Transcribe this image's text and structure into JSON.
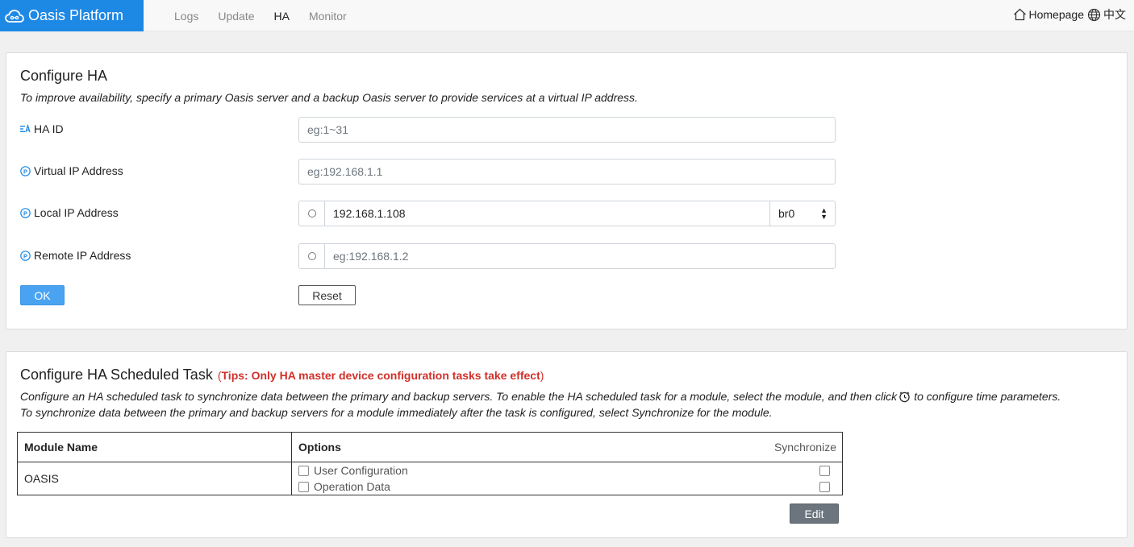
{
  "brand": {
    "name": "Oasis Platform"
  },
  "nav": {
    "items": [
      {
        "label": "Logs"
      },
      {
        "label": "Update"
      },
      {
        "label": "HA"
      },
      {
        "label": "Monitor"
      }
    ],
    "active": "HA"
  },
  "top_right": {
    "homepage": "Homepage",
    "language": "中文"
  },
  "configure_ha": {
    "title": "Configure HA",
    "description": "To improve availability, specify a primary Oasis server and a backup Oasis server to provide services at a virtual IP address.",
    "ha_id": {
      "label": "HA ID",
      "placeholder": "eg:1~31",
      "value": ""
    },
    "virtual_ip": {
      "label": "Virtual IP Address",
      "placeholder": "eg:192.168.1.1",
      "value": ""
    },
    "local_ip": {
      "label": "Local IP Address",
      "value": "192.168.1.108",
      "interface": "br0"
    },
    "remote_ip": {
      "label": "Remote IP Address",
      "placeholder": "eg:192.168.1.2",
      "value": ""
    },
    "ok_label": "OK",
    "reset_label": "Reset"
  },
  "scheduled_task": {
    "title": "Configure HA Scheduled Task",
    "tips_open": "(",
    "tips": "Tips: Only HA master device configuration tasks take effect",
    "tips_close": ")",
    "desc_line1a": "Configure an HA scheduled task to synchronize data between the primary and backup servers. To enable the HA scheduled task for a module, select the module, and then click",
    "desc_line1b": "to configure time parameters.",
    "desc_line2": "To synchronize data between the primary and backup servers for a module immediately after the task is configured, select Synchronize for the module.",
    "table": {
      "col_module": "Module Name",
      "col_options": "Options",
      "col_sync": "Synchronize",
      "rows": [
        {
          "module": "OASIS",
          "options": [
            "User Configuration",
            "Operation Data"
          ]
        }
      ]
    },
    "edit_label": "Edit"
  },
  "colors": {
    "brand_blue": "#1e88e5",
    "ok_blue": "#4aa3f0",
    "tips_red": "#d0302a",
    "edit_gray": "#6c757d"
  }
}
